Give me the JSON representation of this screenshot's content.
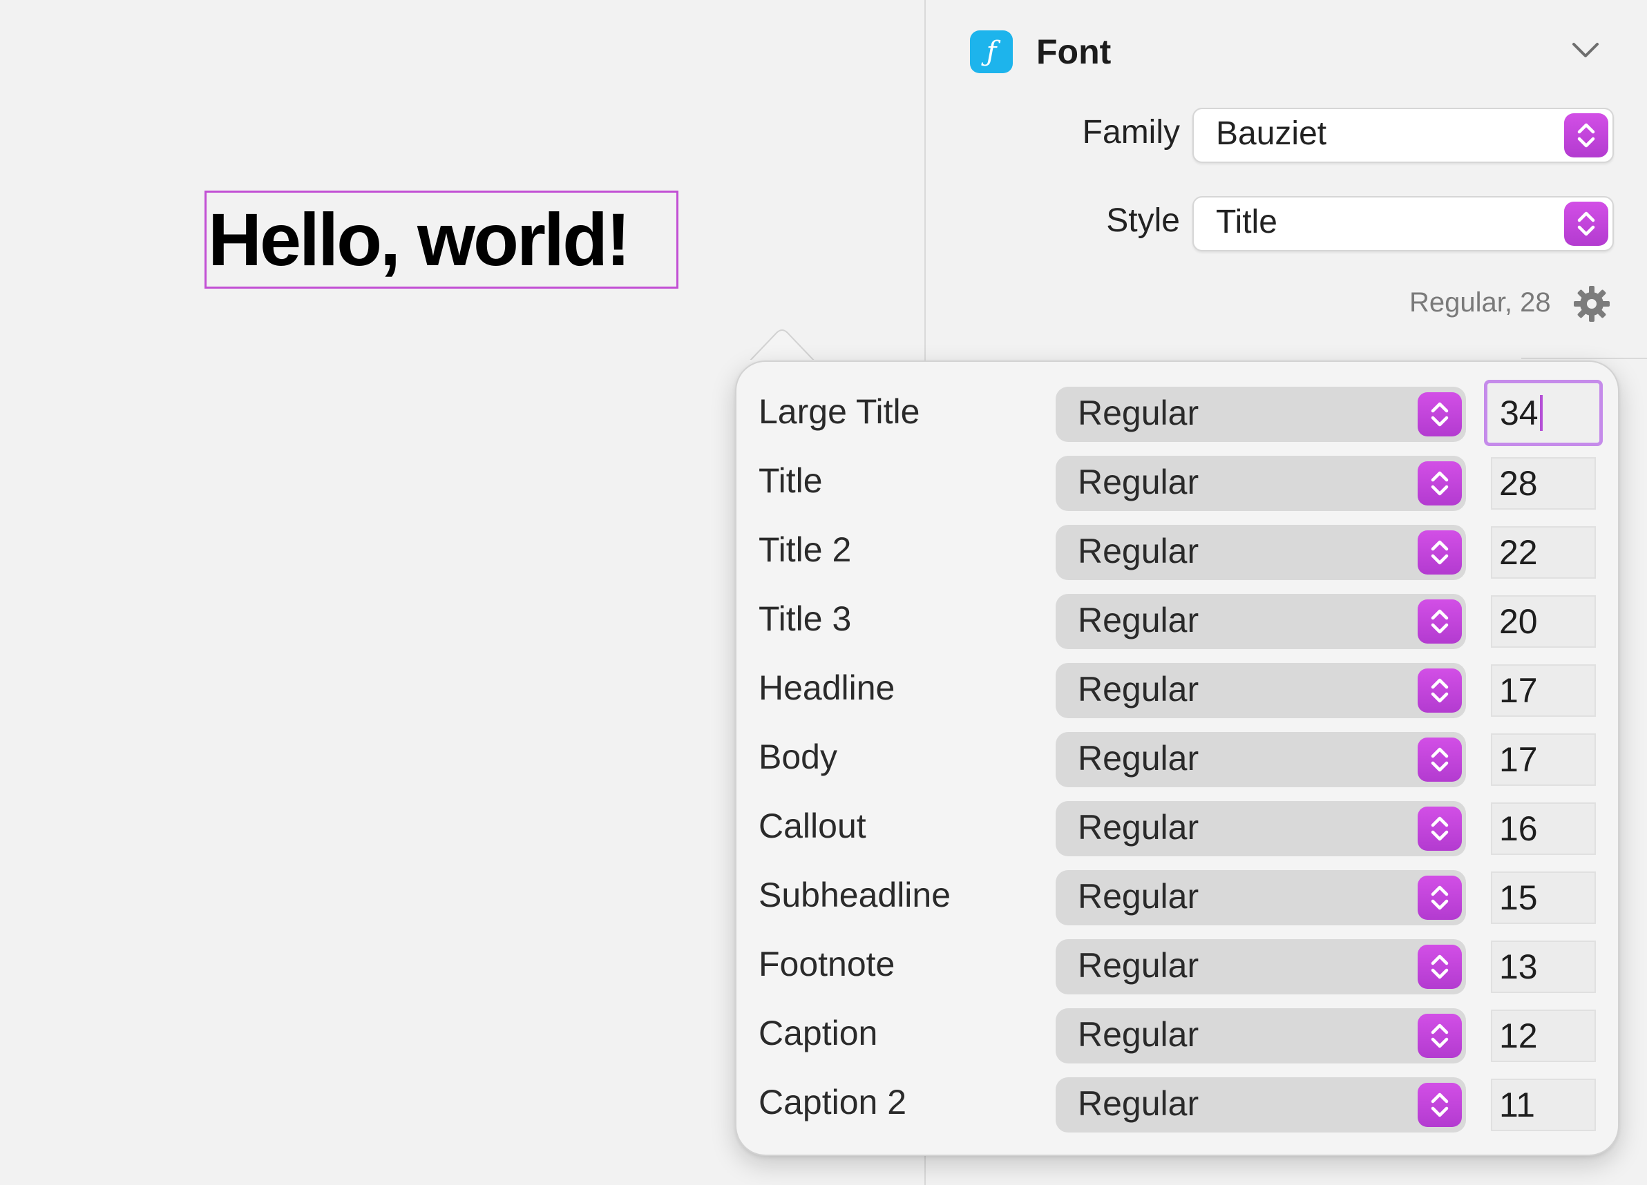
{
  "canvas": {
    "preview_text": "Hello, world!",
    "selection_color": "#c24fd4"
  },
  "inspector": {
    "section": {
      "icon": "font-f-icon",
      "icon_glyph": "ƒ",
      "title": "Font",
      "collapse_icon": "chevron-down-icon"
    },
    "family": {
      "label": "Family",
      "value": "Bauziet"
    },
    "style": {
      "label": "Style",
      "value": "Title"
    },
    "style_summary": "Regular, 28",
    "settings_icon": "gear-icon",
    "accent_color": "#c84ae0",
    "icon_color": "#1db4ec"
  },
  "popover": {
    "rows": [
      {
        "name": "Large Title",
        "weight": "Regular",
        "size": "34"
      },
      {
        "name": "Title",
        "weight": "Regular",
        "size": "28"
      },
      {
        "name": "Title 2",
        "weight": "Regular",
        "size": "22"
      },
      {
        "name": "Title 3",
        "weight": "Regular",
        "size": "20"
      },
      {
        "name": "Headline",
        "weight": "Regular",
        "size": "17"
      },
      {
        "name": "Body",
        "weight": "Regular",
        "size": "17"
      },
      {
        "name": "Callout",
        "weight": "Regular",
        "size": "16"
      },
      {
        "name": "Subheadline",
        "weight": "Regular",
        "size": "15"
      },
      {
        "name": "Footnote",
        "weight": "Regular",
        "size": "13"
      },
      {
        "name": "Caption",
        "weight": "Regular",
        "size": "12"
      },
      {
        "name": "Caption 2",
        "weight": "Regular",
        "size": "11"
      }
    ],
    "active_row": 0
  }
}
